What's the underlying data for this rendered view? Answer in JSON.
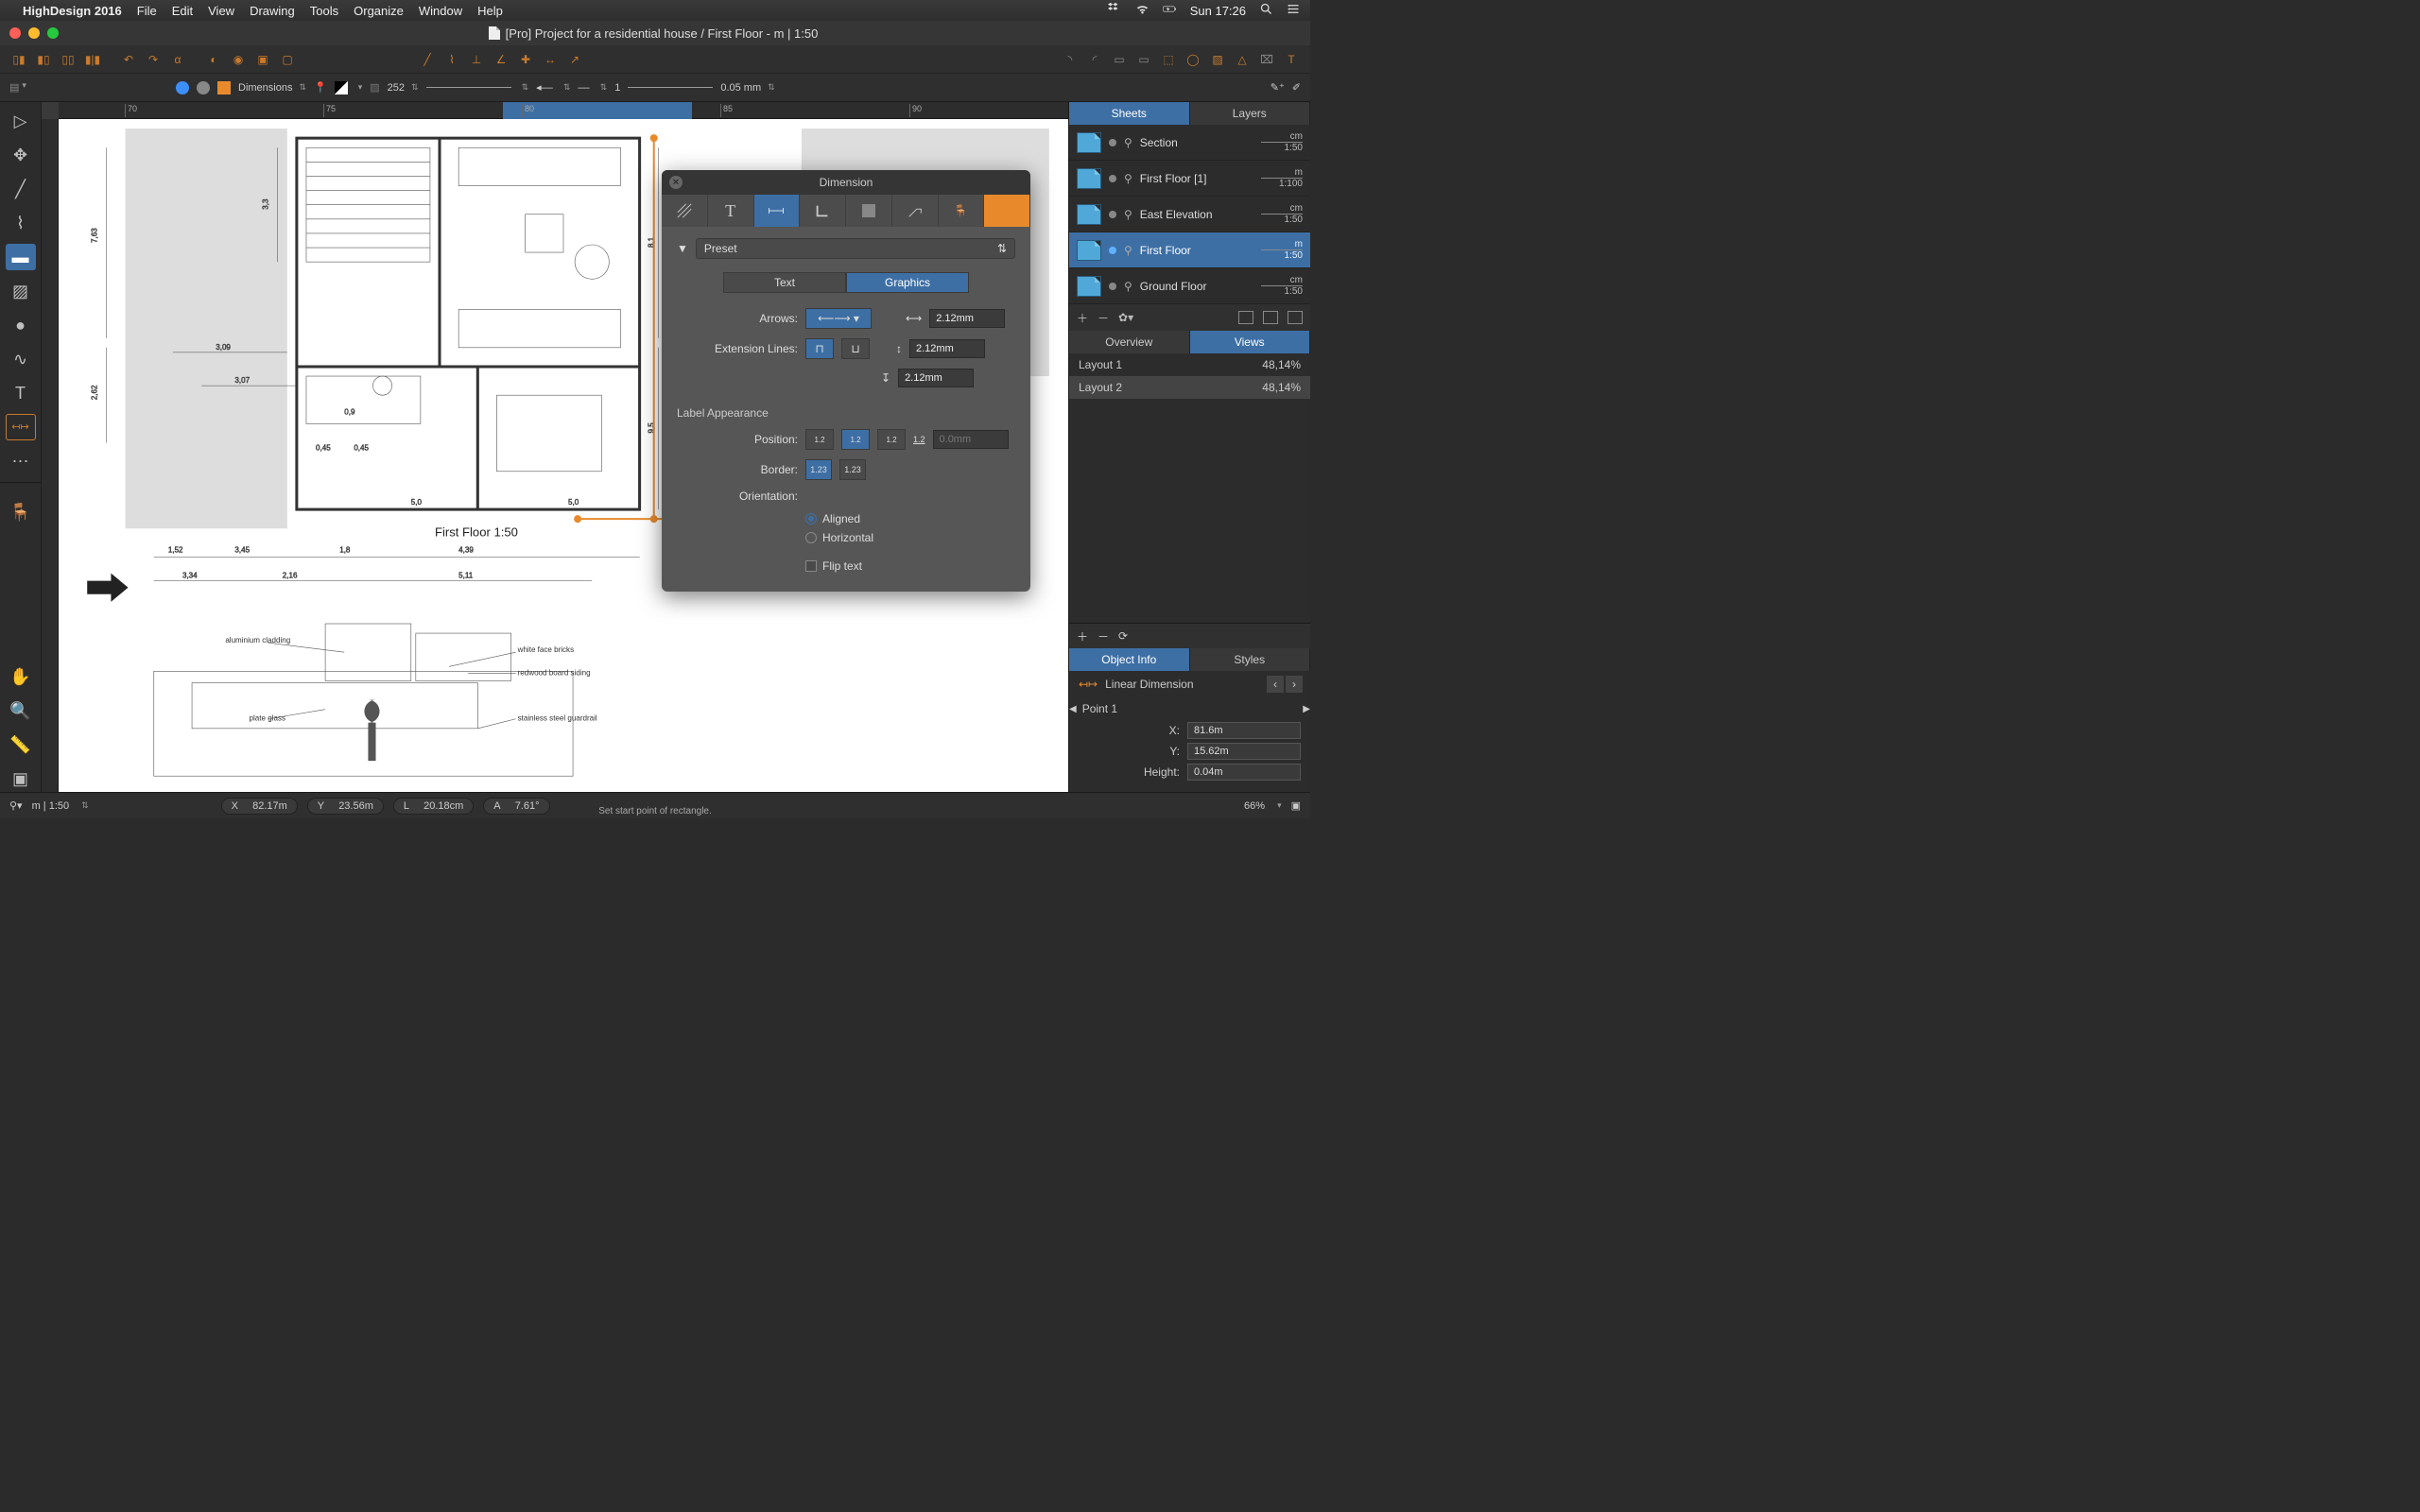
{
  "menubar": {
    "app": "HighDesign 2016",
    "items": [
      "File",
      "Edit",
      "View",
      "Drawing",
      "Tools",
      "Organize",
      "Window",
      "Help"
    ],
    "clock": "Sun 17:26"
  },
  "window": {
    "title": "[Pro] Project for a residential house / First Floor - m | 1:50"
  },
  "toolbar2": {
    "layer": "Dimensions",
    "num1": "252",
    "num2": "1",
    "lineweight": "0.05 mm"
  },
  "right": {
    "tabs": [
      "Sheets",
      "Layers"
    ],
    "sheets": [
      {
        "name": "Section",
        "unit": "cm",
        "scale": "1:50",
        "active": false
      },
      {
        "name": "First Floor [1]",
        "unit": "m",
        "scale": "1:100",
        "active": false
      },
      {
        "name": "East Elevation",
        "unit": "cm",
        "scale": "1:50",
        "active": false
      },
      {
        "name": "First Floor",
        "unit": "m",
        "scale": "1:50",
        "active": true
      },
      {
        "name": "Ground Floor",
        "unit": "cm",
        "scale": "1:50",
        "active": false
      }
    ],
    "viewTabs": [
      "Overview",
      "Views"
    ],
    "layouts": [
      {
        "name": "Layout 1",
        "pct": "48,14%",
        "sel": false
      },
      {
        "name": "Layout 2",
        "pct": "48,14%",
        "sel": true
      }
    ],
    "infoTabs": [
      "Object Info",
      "Styles"
    ],
    "objtype": "Linear Dimension",
    "point": "Point 1",
    "x": "81.6m",
    "y": "15.62m",
    "h": "0.04m",
    "xl": "X:",
    "yl": "Y:",
    "hl": "Height:"
  },
  "dim": {
    "title": "Dimension",
    "preset": "Preset",
    "subtabs": [
      "Text",
      "Graphics"
    ],
    "arrows": "Arrows:",
    "ext": "Extension Lines:",
    "v1": "2.12mm",
    "v2": "2.12mm",
    "v3": "2.12mm",
    "labelapp": "Label Appearance",
    "position": "Position:",
    "border": "Border:",
    "orientation": "Orientation:",
    "aligned": "Aligned",
    "horizontal": "Horizontal",
    "flip": "Flip text",
    "posval": "0.0mm",
    "b1": "1.23",
    "b2": "1.23",
    "posmini": "1.2"
  },
  "status": {
    "units": "m | 1:50",
    "x": "82.17m",
    "y": "23.56m",
    "l": "20.18cm",
    "a": "7.61°",
    "xl": "X",
    "yl": "Y",
    "ll": "L",
    "al": "A",
    "zoom": "66%",
    "hint": "Set start point of rectangle."
  },
  "canvas": {
    "label": "First Floor 1:50",
    "dims": [
      "7,63",
      "3,3",
      "2,62",
      "3,09",
      "3,07",
      "0,9",
      "0,45",
      "0,45",
      "1,52",
      "3,45",
      "1,8",
      "4,39",
      "3,34",
      "2,16",
      "5,11",
      "8,1",
      "9,5",
      "5,0",
      "5,0"
    ],
    "ann": [
      "aluminium  cladding",
      "white face bricks",
      "redwood board siding",
      "plate glass",
      "stainless steel guardrail"
    ],
    "rulerMarks": [
      "70",
      "75",
      "80",
      "85",
      "90"
    ]
  }
}
